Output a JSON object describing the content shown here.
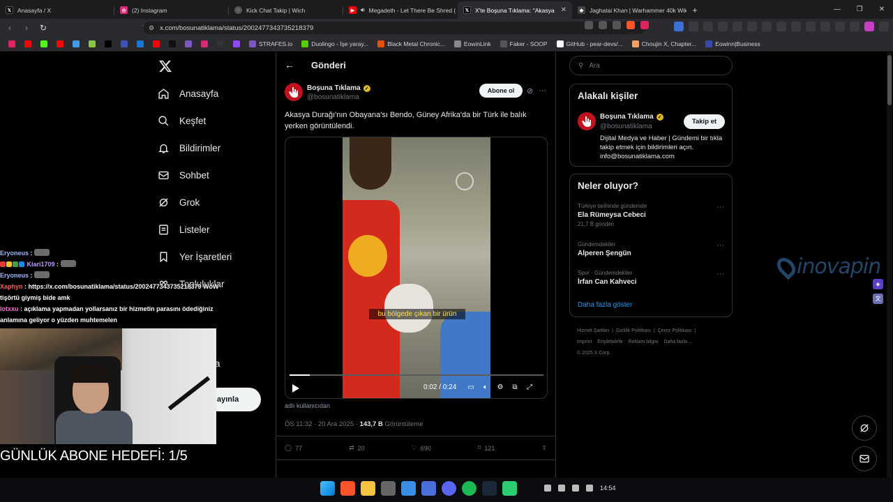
{
  "browser": {
    "tabs": [
      {
        "title": "Anasayfa / X",
        "icon": "x-icon",
        "color": "#000000"
      },
      {
        "title": "(2) Instagram",
        "icon": "instagram-icon",
        "color": "#d62976"
      },
      {
        "title": "Kick Chat Takip | Wich",
        "icon": "globe-icon",
        "color": "#555555"
      },
      {
        "title": "Megadeth - Let There Be Shred (",
        "icon": "youtube-icon",
        "color": "#ff0000"
      },
      {
        "title": "X'te Boşuna Tıklama: \"Akasya",
        "icon": "x-icon",
        "color": "#000000"
      },
      {
        "title": "Jaghatai Khan | Warhammer 40k Wik",
        "icon": "fandom-icon",
        "color": "#444444"
      }
    ],
    "new_tab": "+",
    "url": "x.com/bosunatiklama/status/2002477343735218379",
    "bookmarks": [
      {
        "label": "",
        "color": "#e0245e"
      },
      {
        "label": "",
        "color": "#ff0000"
      },
      {
        "label": "",
        "color": "#53fc18"
      },
      {
        "label": "",
        "color": "#ff0000"
      },
      {
        "label": "",
        "color": "#3f9ee8"
      },
      {
        "label": "",
        "color": "#8bc34a"
      },
      {
        "label": "",
        "color": "#000000"
      },
      {
        "label": "",
        "color": "#3f51b5"
      },
      {
        "label": "",
        "color": "#1976d2"
      },
      {
        "label": "",
        "color": "#ff0000"
      },
      {
        "label": "",
        "color": "#111111"
      },
      {
        "label": "",
        "color": "#7e57c2"
      },
      {
        "label": "",
        "color": "#d62976"
      },
      {
        "label": "",
        "color": "#333333"
      },
      {
        "label": "",
        "color": "#9146ff"
      },
      {
        "label": "STRAFES.io",
        "color": "#7e57c2"
      },
      {
        "label": "Duolingo - İşe yaray...",
        "color": "#58cc02"
      },
      {
        "label": "Black Metal Chronic...",
        "color": "#e65100"
      },
      {
        "label": "EowinLink",
        "color": "#888888"
      },
      {
        "label": "Faker - SOOP",
        "color": "#555555"
      },
      {
        "label": "GitHub - pear-devs/...",
        "color": "#ffffff"
      },
      {
        "label": "Choujin X, Chapter...",
        "color": "#f4a261"
      },
      {
        "label": "Eowinn|Business",
        "color": "#3949ab"
      }
    ]
  },
  "nav": {
    "items": [
      {
        "label": "Anasayfa",
        "icon": "home-icon"
      },
      {
        "label": "Keşfet",
        "icon": "search-icon"
      },
      {
        "label": "Bildirimler",
        "icon": "bell-icon"
      },
      {
        "label": "Sohbet",
        "icon": "mail-icon"
      },
      {
        "label": "Grok",
        "icon": "grok-icon"
      },
      {
        "label": "Listeler",
        "icon": "list-icon"
      },
      {
        "label": "Yer İşaretleri",
        "icon": "bookmark-icon"
      },
      {
        "label": "Topluluklar",
        "icon": "community-icon"
      }
    ],
    "partial_label": "la",
    "post_button": "ayınla"
  },
  "post": {
    "header_title": "Gönderi",
    "author_name": "Boşuna Tıklama",
    "author_handle": "@bosunatiklama",
    "subscribe": "Abone ol",
    "text": "Akasya Durağı'nın Obayana'sı Bendo, Güney Afrika'da bir Türk ile balık yerken görüntülendi.",
    "video_caption": "bu bölgede çıkan bir ürün",
    "video_time": "0:02 / 0:24",
    "video_progress": 0.08,
    "source_note": "adlı kullanıcıdan",
    "timestamp": "ÖS 11:32 · 20 Ara 2025 · ",
    "views": "143,7 B",
    "views_label": "Görüntüleme",
    "stats": {
      "replies": "77",
      "reposts": "20",
      "likes": "690",
      "bookmarks": "121"
    }
  },
  "sidebar": {
    "search_placeholder": "Ara",
    "people_title": "Alakalı kişiler",
    "person": {
      "name": "Boşuna Tıklama",
      "handle": "@bosunatiklama",
      "follow": "Takip et",
      "bio": "Dijital Medya ve Haber | Gündemi bir tıkla takip etmek için bildirimleri açın. info@bosunatiklama.com"
    },
    "trends_title": "Neler oluyor?",
    "trends": [
      {
        "context": "Türkiye tarihinde gündemde",
        "name": "Ela Rümeysa Cebeci",
        "count": "21,7 B gönderi"
      },
      {
        "context": "Gündemdekiler",
        "name": "Alperen Şengün",
        "count": ""
      },
      {
        "context": "Spor · Gündemdekiler",
        "name": "İrfan Can Kahveci",
        "count": ""
      }
    ],
    "show_more": "Daha fazla göster",
    "footer": [
      "Hizmet Şartları",
      "Gizlilik Politikası",
      "Çerez Politikası",
      "Imprint",
      "Erişilebilirlik",
      "Reklam bilgisi",
      "Daha fazla ...",
      "© 2025 X Corp."
    ]
  },
  "overlay": {
    "chat": [
      {
        "user": "Eryoneus",
        "msg": ""
      },
      {
        "user": "Kiari1709",
        "msg": ""
      },
      {
        "user": "Eryoneus",
        "msg": ""
      },
      {
        "user": "Xaphyn",
        "msg": "https://x.com/bosunatiklama/status/2002477343735218379 WoW"
      },
      {
        "user": "",
        "msg": "tişörtü giymiş bide amk"
      },
      {
        "user": "lotxxu",
        "msg": "açıklama yapmadan yollarsanız bir hizmetin parasını ödediğiniz"
      },
      {
        "user": "",
        "msg": "anlamına geliyor o yüzden muhtemelen"
      }
    ],
    "goal": "GÜNLÜK ABONE HEDEFİ: 1/5",
    "watermark": "inovapin"
  },
  "taskbar": {
    "time": "14:54"
  }
}
